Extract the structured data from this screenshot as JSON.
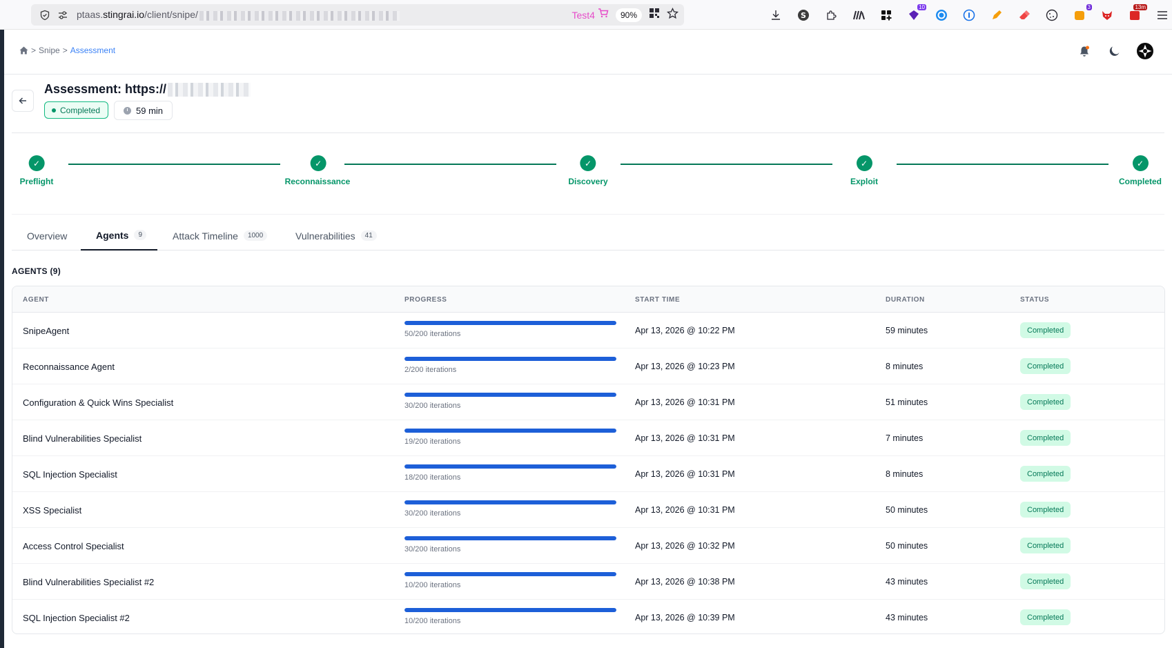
{
  "browser": {
    "url_prefix": "ptaas.",
    "url_host": "stingrai.io",
    "url_path": "/client/snipe/",
    "profile_label": "Test4",
    "zoom": "90%",
    "extension_badges": {
      "ext_purple": "10",
      "ext_orange": "3",
      "ext_red": "13m"
    }
  },
  "breadcrumb": {
    "sep": ">",
    "item1": "Snipe",
    "current": "Assessment"
  },
  "assessment": {
    "title": "Assessment: https://",
    "status": "Completed",
    "duration": "59 min"
  },
  "stepper": {
    "steps": [
      {
        "label": "Preflight"
      },
      {
        "label": "Reconnaissance"
      },
      {
        "label": "Discovery"
      },
      {
        "label": "Exploit"
      },
      {
        "label": "Completed"
      }
    ]
  },
  "tabs": [
    {
      "label": "Overview",
      "count": ""
    },
    {
      "label": "Agents",
      "count": "9"
    },
    {
      "label": "Attack Timeline",
      "count": "1000"
    },
    {
      "label": "Vulnerabilities",
      "count": "41"
    }
  ],
  "section_title": "AGENTS (9)",
  "table": {
    "headers": {
      "agent": "AGENT",
      "progress": "PROGRESS",
      "start": "START TIME",
      "duration": "DURATION",
      "status": "STATUS"
    },
    "rows": [
      {
        "agent": "SnipeAgent",
        "iterations": "50/200 iterations",
        "progress": 1.0,
        "start": "Apr 13, 2026 @ 10:22 PM",
        "duration": "59 minutes",
        "status": "Completed"
      },
      {
        "agent": "Reconnaissance Agent",
        "iterations": "2/200 iterations",
        "progress": 1.0,
        "start": "Apr 13, 2026 @ 10:23 PM",
        "duration": "8 minutes",
        "status": "Completed"
      },
      {
        "agent": "Configuration & Quick Wins Specialist",
        "iterations": "30/200 iterations",
        "progress": 1.0,
        "start": "Apr 13, 2026 @ 10:31 PM",
        "duration": "51 minutes",
        "status": "Completed"
      },
      {
        "agent": "Blind Vulnerabilities Specialist",
        "iterations": "19/200 iterations",
        "progress": 1.0,
        "start": "Apr 13, 2026 @ 10:31 PM",
        "duration": "7 minutes",
        "status": "Completed"
      },
      {
        "agent": "SQL Injection Specialist",
        "iterations": "18/200 iterations",
        "progress": 1.0,
        "start": "Apr 13, 2026 @ 10:31 PM",
        "duration": "8 minutes",
        "status": "Completed"
      },
      {
        "agent": "XSS Specialist",
        "iterations": "30/200 iterations",
        "progress": 1.0,
        "start": "Apr 13, 2026 @ 10:31 PM",
        "duration": "50 minutes",
        "status": "Completed"
      },
      {
        "agent": "Access Control Specialist",
        "iterations": "30/200 iterations",
        "progress": 1.0,
        "start": "Apr 13, 2026 @ 10:32 PM",
        "duration": "50 minutes",
        "status": "Completed"
      },
      {
        "agent": "Blind Vulnerabilities Specialist #2",
        "iterations": "10/200 iterations",
        "progress": 1.0,
        "start": "Apr 13, 2026 @ 10:38 PM",
        "duration": "43 minutes",
        "status": "Completed"
      },
      {
        "agent": "SQL Injection Specialist #2",
        "iterations": "10/200 iterations",
        "progress": 1.0,
        "start": "Apr 13, 2026 @ 10:39 PM",
        "duration": "43 minutes",
        "status": "Completed"
      }
    ]
  }
}
